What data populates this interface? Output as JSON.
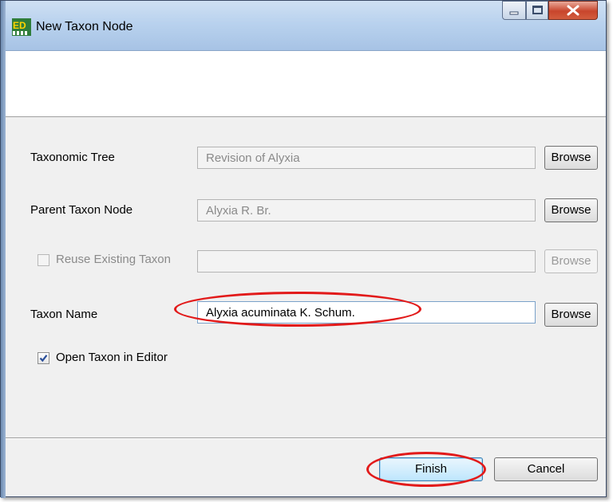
{
  "window": {
    "title": "New Taxon Node",
    "app_icon": "eclipse-taxeditor-icon",
    "controls": [
      "minimize-icon",
      "maximize-icon",
      "close-icon"
    ]
  },
  "form": {
    "taxonomic_tree": {
      "label": "Taxonomic Tree",
      "value": "Revision of Alyxia",
      "browse": "Browse"
    },
    "parent_taxon_node": {
      "label": "Parent Taxon Node",
      "value": "Alyxia R. Br.",
      "browse": "Browse"
    },
    "reuse_existing_taxon": {
      "label": "Reuse Existing Taxon",
      "checked": false,
      "enabled": false,
      "value": "",
      "browse": "Browse"
    },
    "taxon_name": {
      "label": "Taxon Name",
      "value": "Alyxia acuminata K. Schum.",
      "browse": "Browse"
    },
    "open_in_editor": {
      "label": "Open Taxon in Editor",
      "checked": true
    }
  },
  "footer": {
    "finish": "Finish",
    "cancel": "Cancel"
  },
  "colors": {
    "annotation": "#e21a1a",
    "default_button": "#bee6fd"
  }
}
